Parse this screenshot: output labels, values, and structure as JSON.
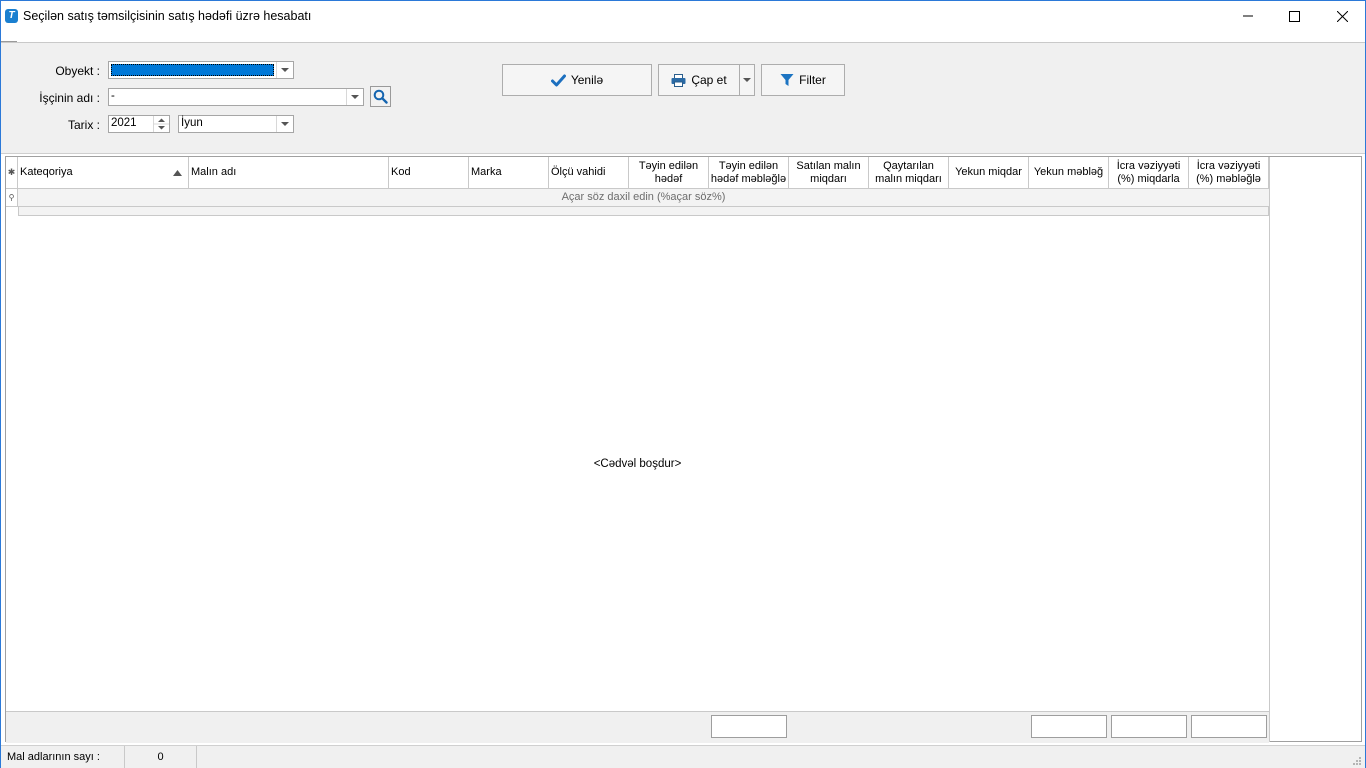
{
  "window": {
    "title": "Seçilən satış təmsilçisinin satış hədəfi üzrə hesabatı",
    "app_icon_letter": "T"
  },
  "form": {
    "obyekt_label": "Obyekt :",
    "obyekt_value": "",
    "isci_label": "İşçinin adı :",
    "isci_value": "-",
    "tarix_label": "Tarix :",
    "year_value": "2021",
    "month_value": "İyun"
  },
  "toolbar": {
    "refresh_label": "Yenilə",
    "print_label": "Çap et",
    "filter_label": "Filter"
  },
  "grid": {
    "columns": [
      "Kateqoriya",
      "Malın adı",
      "Kod",
      "Marka",
      "Ölçü vahidi",
      "Təyin edilən hədəf",
      "Təyin edilən hədəf məbləğlə",
      "Satılan malın miqdarı",
      "Qaytarılan malın miqdarı",
      "Yekun miqdar",
      "Yekun məbləğ",
      "İcra vəziyyəti (%) miqdarla",
      "İcra vəziyyəti (%) məbləğlə"
    ],
    "filter_placeholder": "Açar söz daxil edin (%açar söz%)",
    "empty_text": "<Cədvəl boşdur>"
  },
  "status": {
    "count_label": "Mal adlarının sayı :",
    "count_value": "0"
  },
  "colors": {
    "accent": "#0078d7",
    "window_border": "#2b79d8",
    "icon_blue": "#1a7fd0"
  },
  "icons": [
    "app-icon",
    "minimize-icon",
    "maximize-icon",
    "close-icon",
    "search-icon",
    "check-icon",
    "printer-icon",
    "funnel-icon",
    "chevron-down-icon",
    "sort-asc-icon"
  ]
}
